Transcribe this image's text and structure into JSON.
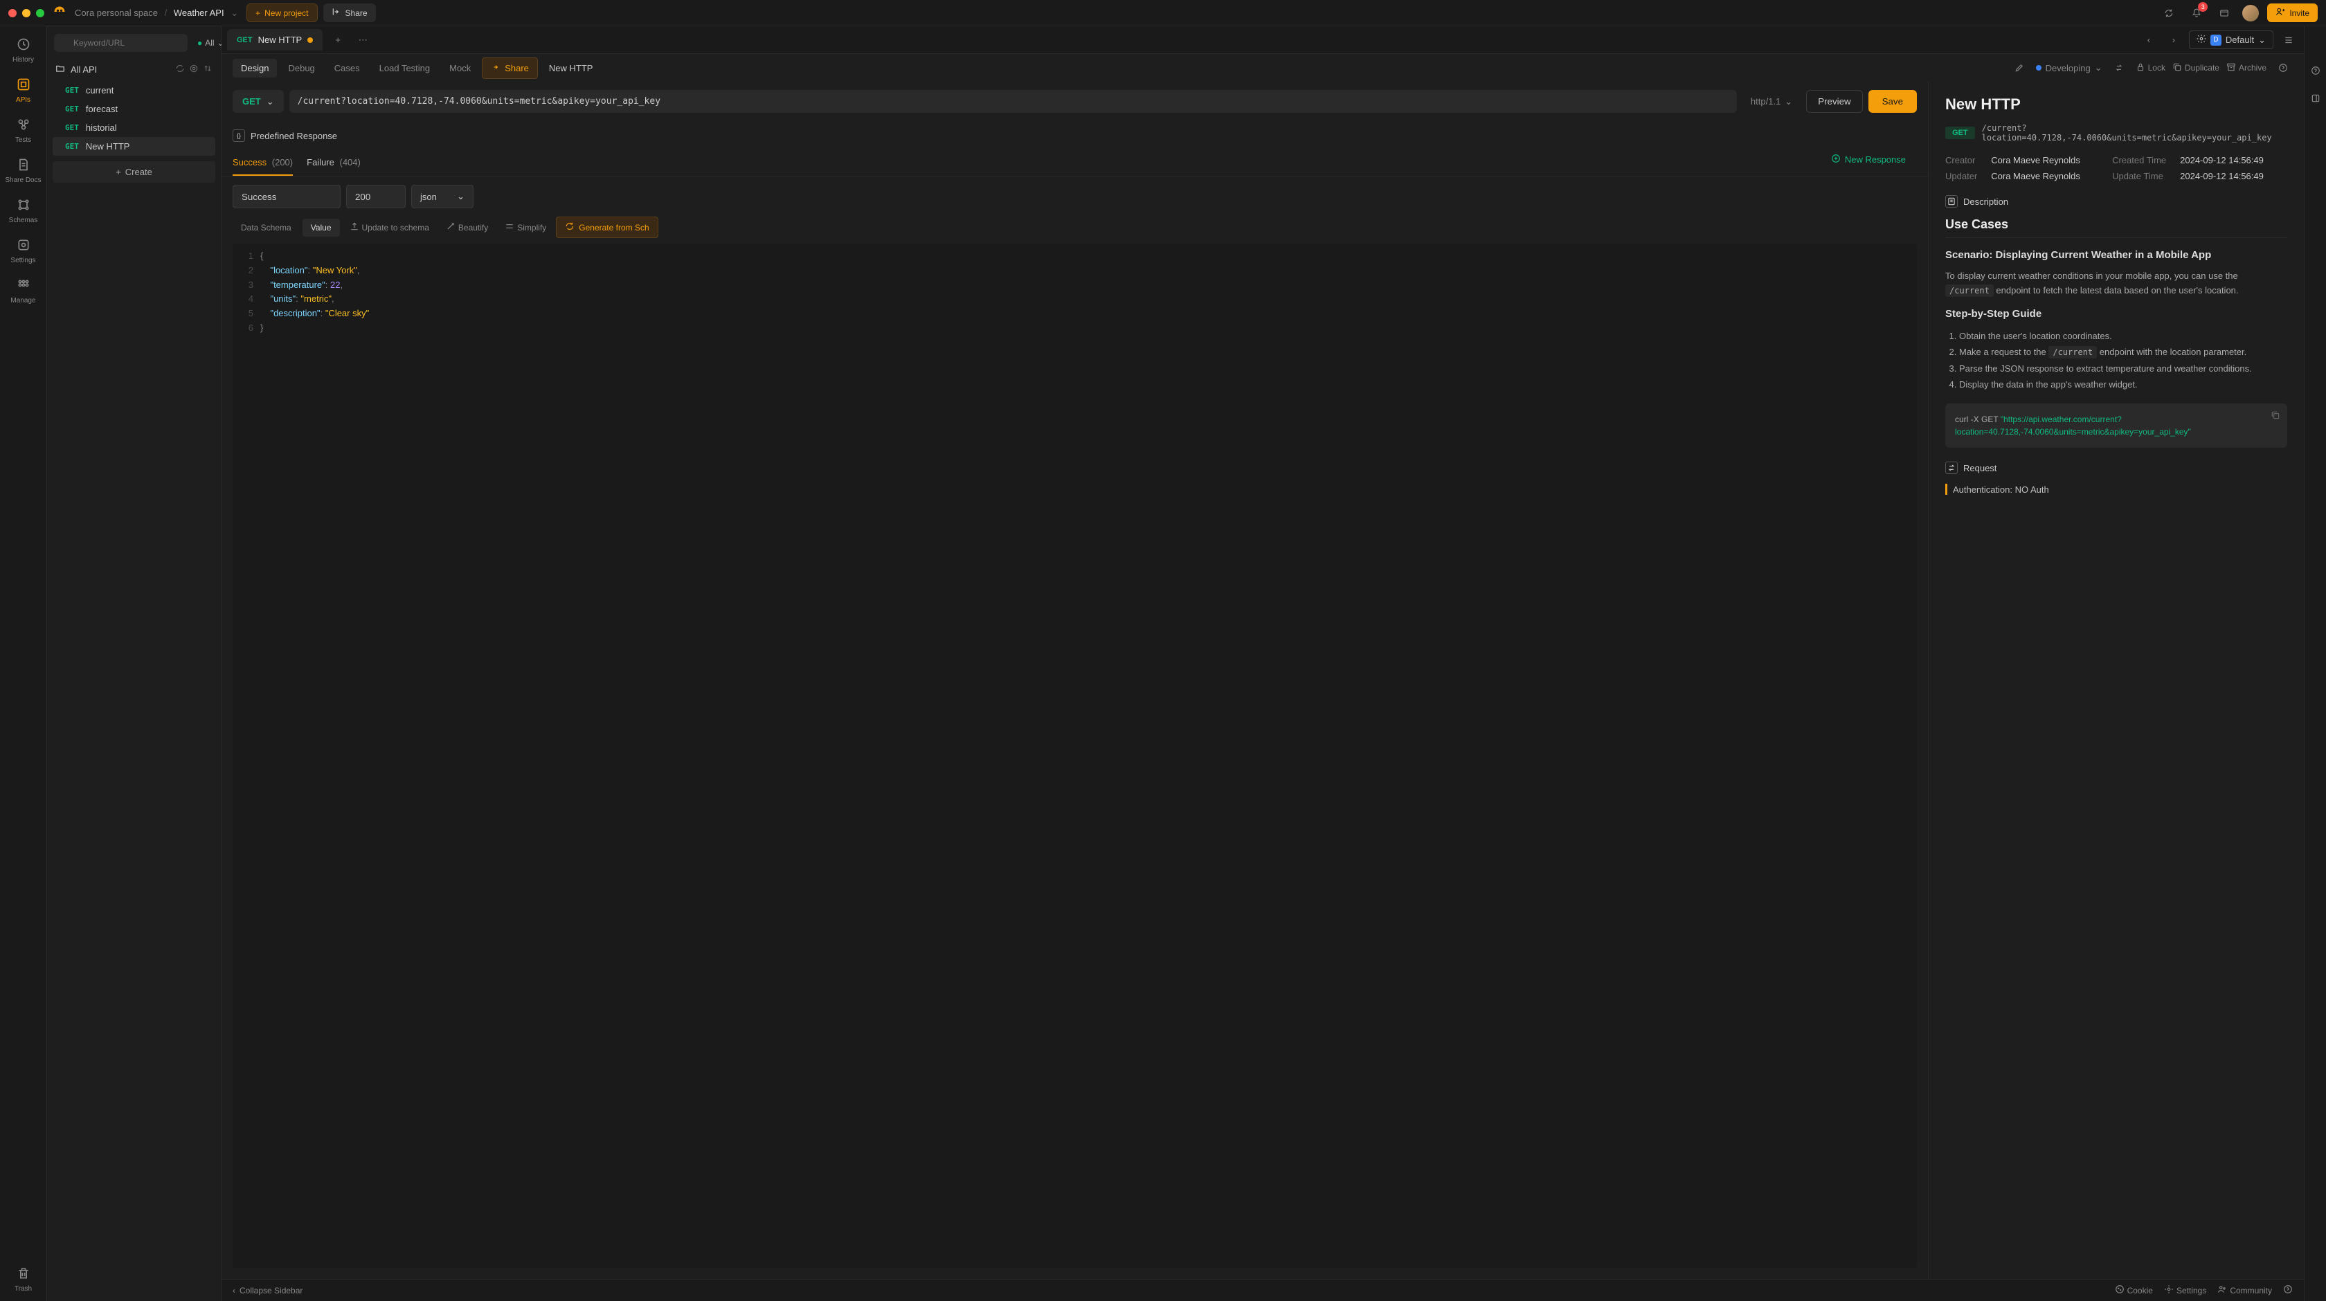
{
  "topbar": {
    "workspace": "Cora personal space",
    "project": "Weather API",
    "new_project": "New project",
    "share": "Share",
    "notification_count": "3",
    "env_label": "Default",
    "env_initial": "D",
    "invite": "Invite"
  },
  "nav": {
    "history": "History",
    "apis": "APIs",
    "tests": "Tests",
    "share_docs": "Share Docs",
    "schemas": "Schemas",
    "settings": "Settings",
    "manage": "Manage",
    "trash": "Trash"
  },
  "sidebar": {
    "search_placeholder": "Keyword/URL",
    "filter": "All",
    "root": "All API",
    "create": "Create",
    "items": [
      {
        "method": "GET",
        "name": "current"
      },
      {
        "method": "GET",
        "name": "forecast"
      },
      {
        "method": "GET",
        "name": "historial"
      },
      {
        "method": "GET",
        "name": "New HTTP"
      }
    ]
  },
  "tab": {
    "method": "GET",
    "name": "New HTTP"
  },
  "subtabs": {
    "design": "Design",
    "debug": "Debug",
    "cases": "Cases",
    "load_testing": "Load Testing",
    "mock": "Mock",
    "share": "Share",
    "title": "New HTTP"
  },
  "toolbar": {
    "status": "Developing",
    "lock": "Lock",
    "duplicate": "Duplicate",
    "archive": "Archive"
  },
  "request": {
    "method": "GET",
    "url": "/current?location=40.7128,-74.0060&units=metric&apikey=your_api_key",
    "http_version": "http/1.1",
    "preview": "Preview",
    "save": "Save"
  },
  "response": {
    "section_title": "Predefined Response",
    "tabs": {
      "success_label": "Success",
      "success_code": "(200)",
      "failure_label": "Failure",
      "failure_code": "(404)"
    },
    "new_response": "New Response",
    "name_value": "Success",
    "code_value": "200",
    "format": "json",
    "schema_tabs": {
      "data_schema": "Data Schema",
      "value": "Value"
    },
    "actions": {
      "update_schema": "Update to schema",
      "beautify": "Beautify",
      "simplify": "Simplify",
      "generate": "Generate from Sch"
    },
    "json_body": {
      "location": "New York",
      "temperature": 22,
      "units": "metric",
      "description": "Clear sky"
    }
  },
  "details": {
    "title": "New HTTP",
    "method": "GET",
    "path": "/current?location=40.7128,-74.0060&units=metric&apikey=your_api_key",
    "creator_label": "Creator",
    "creator": "Cora Maeve Reynolds",
    "created_label": "Created Time",
    "created": "2024-09-12 14:56:49",
    "updater_label": "Updater",
    "updater": "Cora Maeve Reynolds",
    "updated_label": "Update Time",
    "updated": "2024-09-12 14:56:49",
    "description_label": "Description",
    "use_cases_title": "Use Cases",
    "scenario_title": "Scenario: Displaying Current Weather in a Mobile App",
    "scenario_p1_a": "To display current weather conditions in your mobile app, you can use the ",
    "scenario_code1": "/current",
    "scenario_p1_b": " endpoint to fetch the latest data based on the user's location.",
    "guide_title": "Step-by-Step Guide",
    "steps": [
      "Obtain the user's location coordinates.",
      "Make a request to the /current endpoint with the location parameter.",
      "Parse the JSON response to extract temperature and weather conditions.",
      "Display the data in the app's weather widget."
    ],
    "curl_prefix": "curl -X GET ",
    "curl_url": "\"https://api.weather.com/current?location=40.7128,-74.0060&units=metric&apikey=your_api_key\"",
    "request_label": "Request",
    "auth_label": "Authentication: NO Auth"
  },
  "footer": {
    "collapse": "Collapse Sidebar",
    "cookie": "Cookie",
    "settings": "Settings",
    "community": "Community"
  }
}
